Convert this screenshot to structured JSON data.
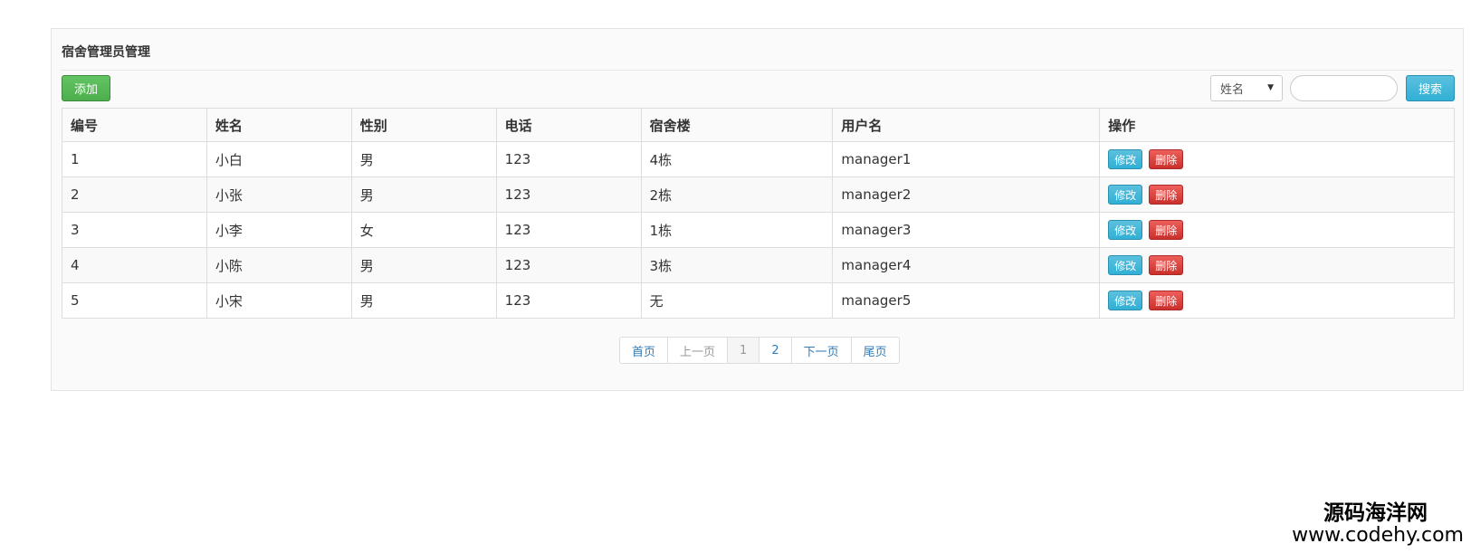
{
  "panel": {
    "title": "宿舍管理员管理"
  },
  "toolbar": {
    "add_label": "添加",
    "search_field_selected": "姓名",
    "search_input_value": "",
    "search_label": "搜索"
  },
  "table": {
    "headers": [
      "编号",
      "姓名",
      "性别",
      "电话",
      "宿舍楼",
      "用户名",
      "操作"
    ],
    "rows": [
      {
        "id": "1",
        "name": "小白",
        "gender": "男",
        "phone": "123",
        "building": "4栋",
        "username": "manager1"
      },
      {
        "id": "2",
        "name": "小张",
        "gender": "男",
        "phone": "123",
        "building": "2栋",
        "username": "manager2"
      },
      {
        "id": "3",
        "name": "小李",
        "gender": "女",
        "phone": "123",
        "building": "1栋",
        "username": "manager3"
      },
      {
        "id": "4",
        "name": "小陈",
        "gender": "男",
        "phone": "123",
        "building": "3栋",
        "username": "manager4"
      },
      {
        "id": "5",
        "name": "小宋",
        "gender": "男",
        "phone": "123",
        "building": "无",
        "username": "manager5"
      }
    ],
    "edit_label": "修改",
    "delete_label": "删除"
  },
  "pagination": {
    "first": "首页",
    "prev": "上一页",
    "pages": [
      "1",
      "2"
    ],
    "next": "下一页",
    "last": "尾页",
    "current": "1"
  },
  "watermark": {
    "cn": "源码海洋网",
    "en": "www.codehy.com"
  },
  "colors": {
    "add_button": "#5cb85c",
    "info_button": "#5bc0de",
    "danger_button": "#d9534f",
    "link": "#337ab7"
  }
}
